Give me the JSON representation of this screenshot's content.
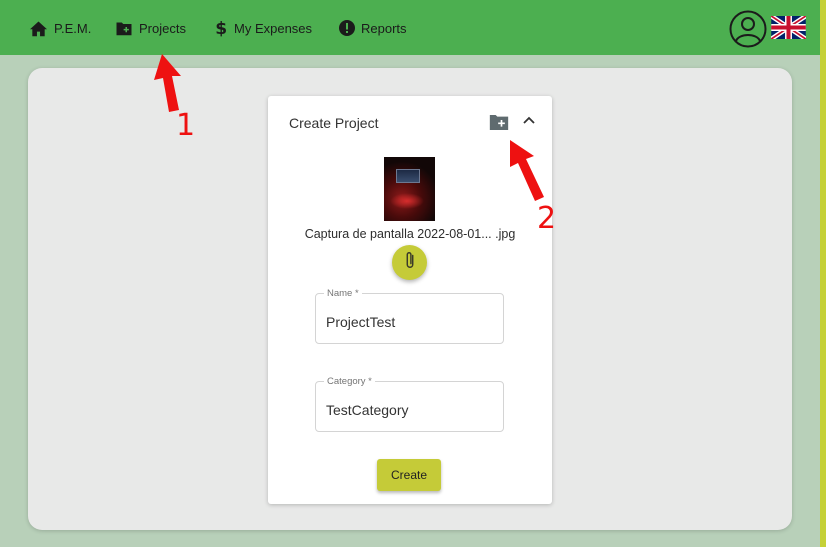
{
  "nav": {
    "items": [
      {
        "label": "P.E.M.",
        "icon": "home-icon"
      },
      {
        "label": "Projects",
        "icon": "folder-plus-icon"
      },
      {
        "label": "My Expenses",
        "icon": "dollar-icon"
      },
      {
        "label": "Reports",
        "icon": "alert-circle-icon"
      }
    ],
    "user_icon": "user-avatar-icon",
    "language_icon": "uk-flag-icon"
  },
  "card": {
    "title": "Create Project",
    "add_icon": "folder-plus-icon",
    "collapse_icon": "chevron-up-icon",
    "file_name": "Captura de pantalla 2022-08-01... .jpg",
    "attach_icon": "paperclip-icon",
    "fields": [
      {
        "label": "Name *",
        "value": "ProjectTest"
      },
      {
        "label": "Category *",
        "value": "TestCategory"
      }
    ],
    "create_label": "Create"
  },
  "annotations": [
    {
      "number": "1",
      "points_to": "Projects"
    },
    {
      "number": "2",
      "points_to": "add-project-folder-icon"
    }
  ],
  "colors": {
    "topbar": "#4caf50",
    "accent": "#c5cb38",
    "background": "#b8d0b9",
    "panel": "#e8e9e8",
    "annotation": "#ee1111"
  }
}
